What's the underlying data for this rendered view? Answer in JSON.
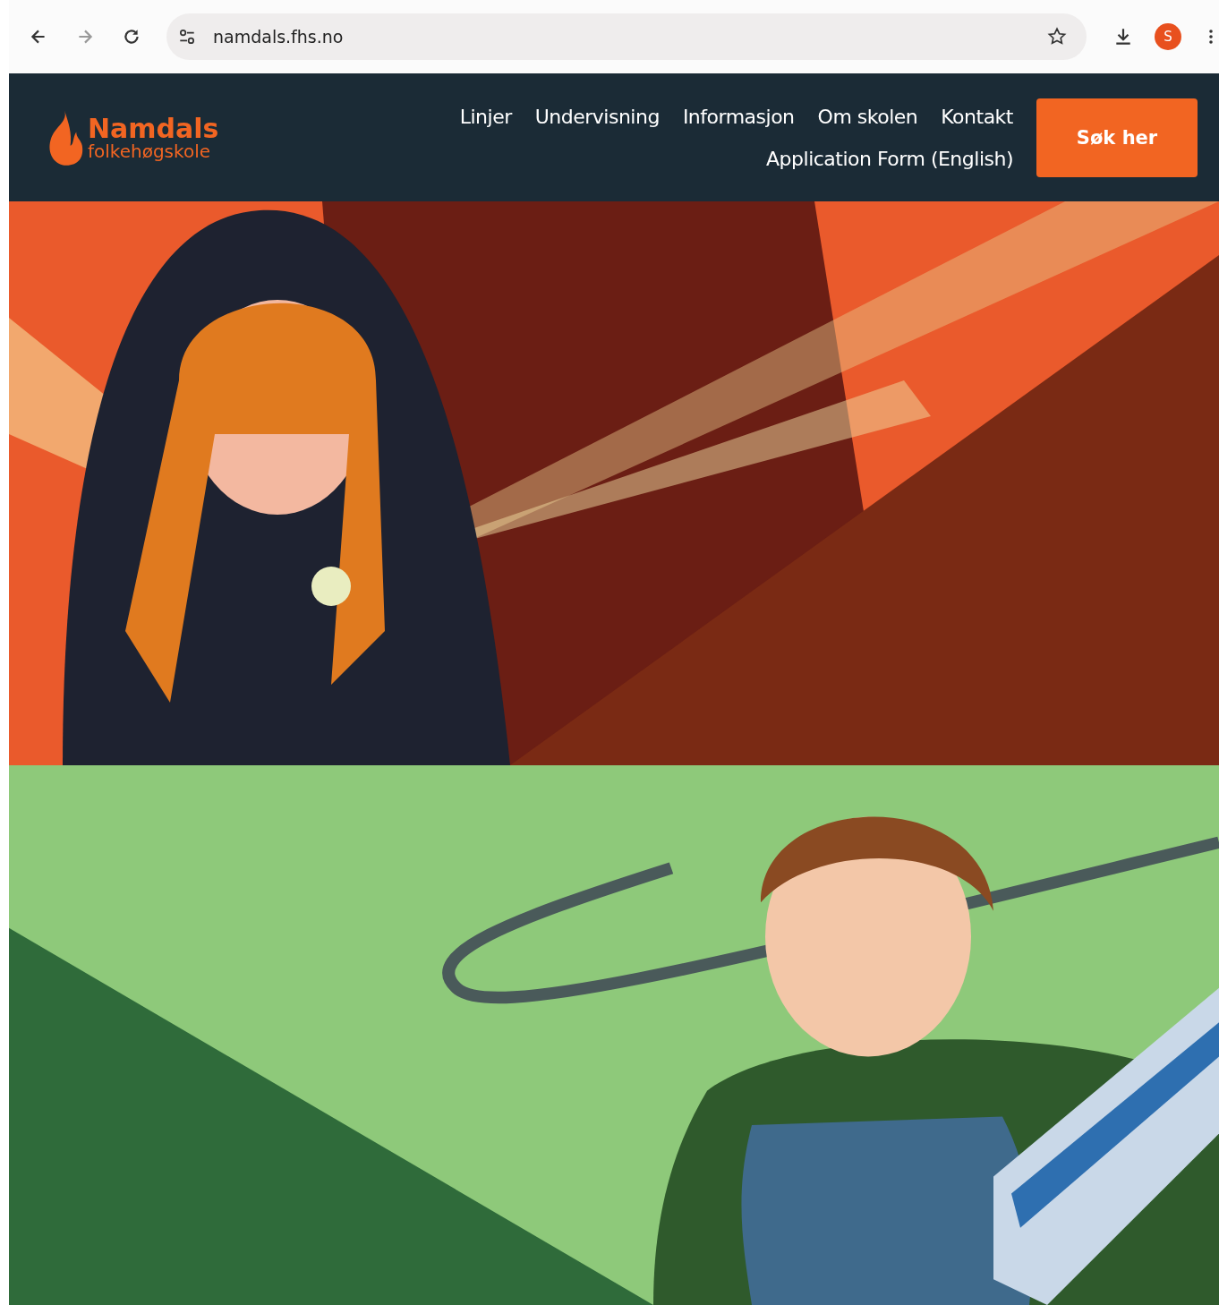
{
  "browser": {
    "url": "namdals.fhs.no",
    "profile_initial": "S"
  },
  "site": {
    "logo": {
      "name": "Namdals",
      "tagline": "folkehøgskole"
    },
    "nav_rows": [
      {
        "links": [
          "Linjer",
          "Undervisning",
          "Informasjon",
          "Om skolen",
          "Kontakt"
        ]
      },
      {
        "links": [
          "Application Form (English)"
        ]
      }
    ],
    "cta": "Søk her"
  }
}
